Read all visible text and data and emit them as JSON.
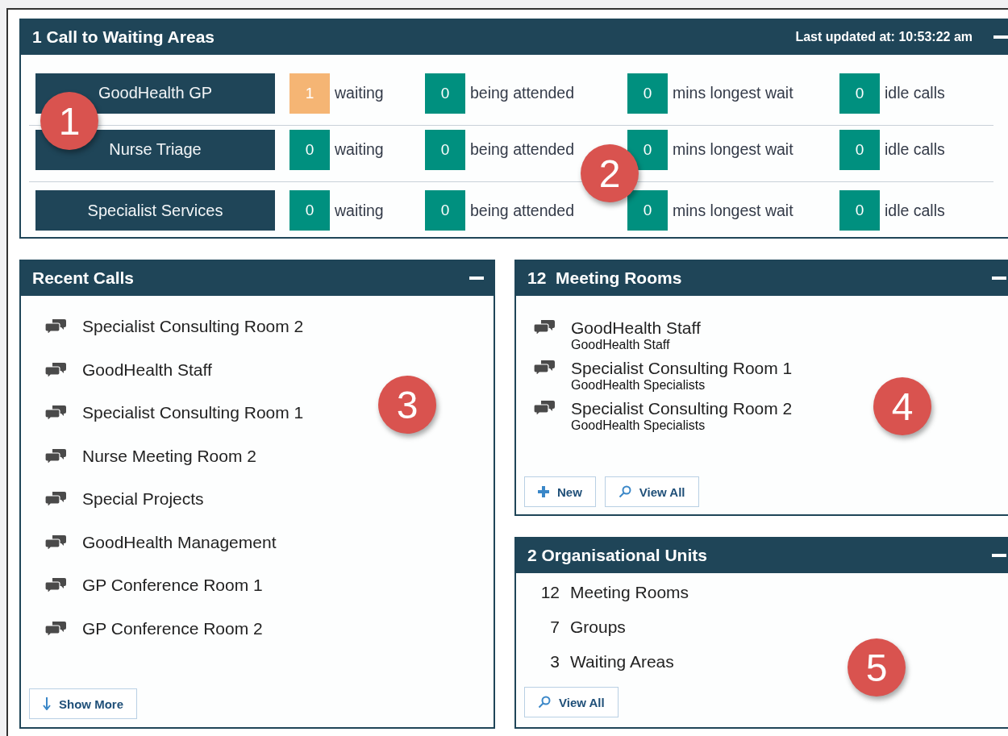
{
  "waiting_panel": {
    "title": "1 Call to Waiting Areas",
    "last_updated": "Last updated at: 10:53:22 am",
    "areas": [
      {
        "name": "GoodHealth GP",
        "stats": [
          {
            "value": "1",
            "label": "waiting",
            "color": "#f5b574"
          },
          {
            "value": "0",
            "label": "being attended",
            "color": "#00907f"
          },
          {
            "value": "0",
            "label": "mins longest wait",
            "color": "#00907f"
          },
          {
            "value": "0",
            "label": "idle calls",
            "color": "#00907f"
          }
        ]
      },
      {
        "name": "Nurse Triage",
        "stats": [
          {
            "value": "0",
            "label": "waiting",
            "color": "#00907f"
          },
          {
            "value": "0",
            "label": "being attended",
            "color": "#00907f"
          },
          {
            "value": "0",
            "label": "mins longest wait",
            "color": "#00907f"
          },
          {
            "value": "0",
            "label": "idle calls",
            "color": "#00907f"
          }
        ]
      },
      {
        "name": "Specialist Services",
        "stats": [
          {
            "value": "0",
            "label": "waiting",
            "color": "#00907f"
          },
          {
            "value": "0",
            "label": "being attended",
            "color": "#00907f"
          },
          {
            "value": "0",
            "label": "mins longest wait",
            "color": "#00907f"
          },
          {
            "value": "0",
            "label": "idle calls",
            "color": "#00907f"
          }
        ]
      }
    ]
  },
  "recent_calls": {
    "title": "Recent Calls",
    "items": [
      "Specialist Consulting Room 2",
      "GoodHealth Staff",
      "Specialist Consulting Room 1",
      "Nurse Meeting Room 2",
      "Special Projects",
      "GoodHealth Management",
      "GP Conference Room 1",
      "GP Conference Room 2"
    ],
    "show_more": "Show More"
  },
  "meeting_rooms": {
    "count": "12",
    "title": "Meeting Rooms",
    "items": [
      {
        "name": "GoodHealth Staff",
        "group": "GoodHealth Staff"
      },
      {
        "name": "Specialist Consulting Room 1",
        "group": "GoodHealth Specialists"
      },
      {
        "name": "Specialist Consulting Room 2",
        "group": "GoodHealth Specialists"
      }
    ],
    "buttons": [
      {
        "kind": "new",
        "label": "New"
      },
      {
        "kind": "view",
        "label": "View All"
      }
    ]
  },
  "org_units": {
    "count": "2",
    "title": "Organisational Units",
    "items": [
      {
        "count": "12",
        "label": "Meeting Rooms"
      },
      {
        "count": "7",
        "label": "Groups"
      },
      {
        "count": "3",
        "label": "Waiting Areas"
      }
    ],
    "buttons": [
      {
        "kind": "view",
        "label": "View All"
      }
    ]
  },
  "callouts": [
    "1",
    "2",
    "3",
    "4",
    "5"
  ]
}
